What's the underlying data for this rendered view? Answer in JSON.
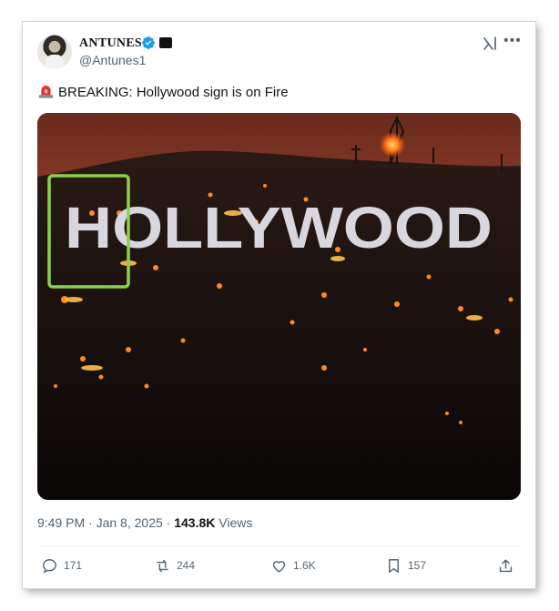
{
  "author": {
    "display_name": "ANTUNES",
    "handle": "@Antunes1",
    "verified": true,
    "accent_color": "#1d9bf0"
  },
  "icons": {
    "verified": "verified-badge-icon",
    "org": "organization-badge-icon",
    "grok": "grok-icon",
    "more": "more-options-icon",
    "siren": "rotating-light-emoji-icon"
  },
  "tweet": {
    "text": "BREAKING: Hollywood sign is on Fire"
  },
  "image": {
    "sign_text": "HOLLYWOOD",
    "highlight_color": "#8bd14a"
  },
  "meta": {
    "time": "9:49 PM",
    "separator1": "·",
    "date": "Jan 8, 2025",
    "separator2": "·",
    "views_count": "143.8K",
    "views_label": "Views"
  },
  "actions": {
    "replies": "171",
    "reposts": "244",
    "likes": "1.6K",
    "bookmarks": "157"
  },
  "colors": {
    "text_primary": "#0f1419",
    "text_secondary": "#536471",
    "divider": "#eff3f4"
  }
}
